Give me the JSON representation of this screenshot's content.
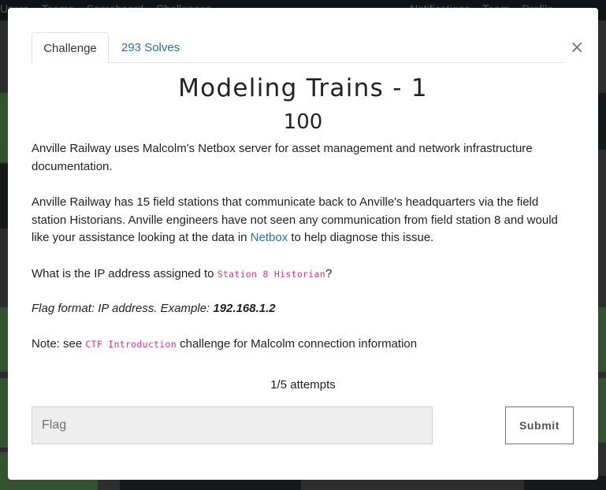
{
  "navbar": {
    "items": [
      "Users",
      "Teams",
      "Scoreboard",
      "Challenges"
    ],
    "right_items": [
      "Notifications",
      "Team",
      "Profile"
    ]
  },
  "modal": {
    "tabs": {
      "challenge": "Challenge",
      "solves": "293 Solves"
    },
    "close_glyph": "×",
    "title": "Modeling Trains - 1",
    "value": "100",
    "description": {
      "p1": "Anville Railway uses Malcolm's Netbox server for asset management and network infrastructure documentation.",
      "p2_before": "Anville Railway has 15 field stations that communicate back to Anville's headquarters via the field station Historians. Anville engineers have not seen any communication from field station 8 and would like your assistance looking at the data in ",
      "p2_link": "Netbox",
      "p2_after": " to help diagnose this issue.",
      "p3_before": "What is the IP address assigned to ",
      "p3_code": "Station 8 Historian",
      "p3_after": "?",
      "p4_before": "Flag format: IP address. Example: ",
      "p4_strong": "192.168.1.2",
      "p5_before": "Note: see ",
      "p5_code": "CTF Introduction",
      "p5_after": " challenge for Malcolm connection information"
    },
    "attempts": "1/5 attempts",
    "flag_placeholder": "Flag",
    "submit_label": "Submit"
  },
  "colors": {
    "link": "#2d6fb0",
    "code": "#d63384",
    "overlay_card_green": "#67a45e",
    "navbar": "#212529"
  }
}
